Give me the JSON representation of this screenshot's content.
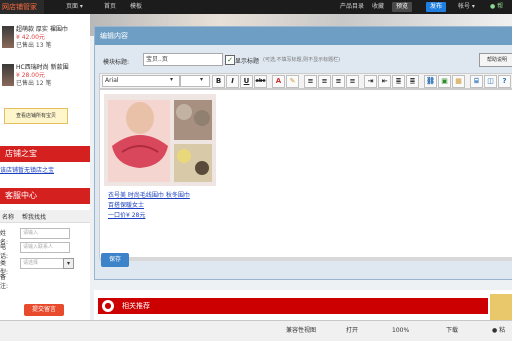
{
  "topbar": {
    "logo": "网店铺管家",
    "nav": [
      "页面 ▾",
      "首页",
      "模板"
    ],
    "right_items": [
      "产品目录",
      "收藏"
    ],
    "btn_preview": "预览",
    "btn_publish": "发布",
    "account": "帐号 ▾",
    "more": "● 帮"
  },
  "sidebar": {
    "products": [
      {
        "title": "超萌款 厚实 裸围巾",
        "price": "¥ 42.00元",
        "sold": "已售出 13 笔"
      },
      {
        "title": "HC西瑞时尚 新款围",
        "price": "¥ 28.00元",
        "sold": "已售出 12 笔"
      }
    ],
    "view_all": "查看店铺所有宝贝",
    "shop_treasure": "店铺之宝",
    "shop_treasure_link": "该店铺暂无镇店之宝",
    "contact_header": "客服中心",
    "contact_tabs": [
      "名称",
      "帮我找找"
    ],
    "fields": [
      {
        "label": "姓名:",
        "placeholder": "请输入"
      },
      {
        "label": "电话:",
        "placeholder": "请输入联系人"
      },
      {
        "label": "类型:",
        "placeholder": "请选择"
      },
      {
        "label": "备注:",
        "placeholder": ""
      }
    ],
    "submit": "提交留言"
  },
  "modal": {
    "title": "编辑内容",
    "form_label": "模块标题:",
    "title_input": "宝贝..页",
    "checkbox_label": "显示标题",
    "hint": "(可选,不填写标题,则不显示标题栏)",
    "help_btn": "帮助说明",
    "font_select": "Arial",
    "size_select": "",
    "toolbar_b": "B",
    "toolbar_i": "I",
    "toolbar_u": "U",
    "toolbar_s": "abc",
    "image_link": "衣号美 时尚毛线围巾 秋冬围巾",
    "image_link2": "百搭保暖女士",
    "image_price": "一口价¥ 28元",
    "save": "保存"
  },
  "bottom": {
    "section_title": "相关推荐"
  },
  "status": {
    "compat": "兼容性视图",
    "open": "打开",
    "zoom": "100%",
    "download": "下载",
    "items": [
      "● 粘"
    ]
  },
  "colors": {
    "topbar": "#1c1c1c",
    "accent_red": "#d52020",
    "modal_head": "#6f9ec4",
    "save_blue": "#3d83c9",
    "link_blue": "#1a3fbf"
  }
}
